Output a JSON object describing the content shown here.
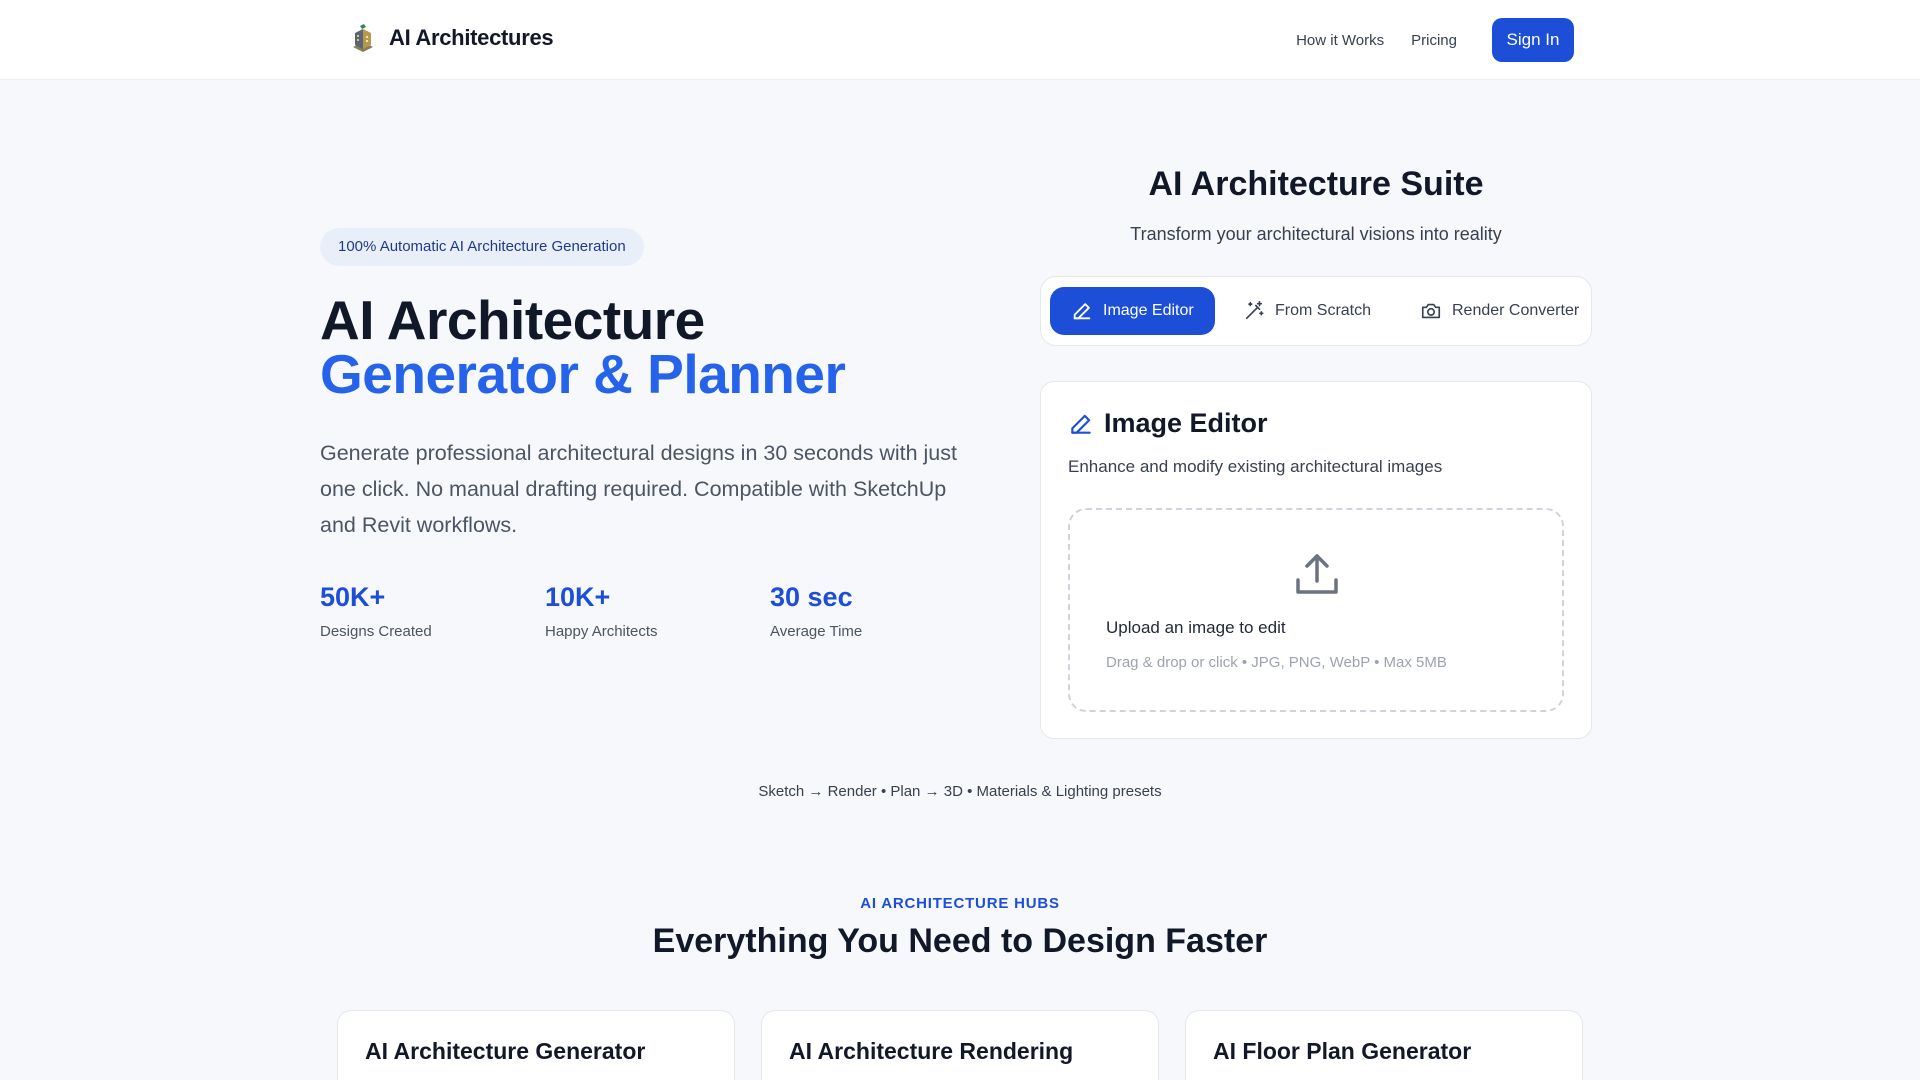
{
  "header": {
    "brand": "AI Architectures",
    "nav": [
      "How it Works",
      "Pricing"
    ],
    "sign_in": "Sign In"
  },
  "hero": {
    "badge": "100% Automatic AI Architecture Generation",
    "title_line1": "AI Architecture",
    "title_line2": "Generator & Planner",
    "lead": "Generate professional architectural designs in 30 seconds with just one click. No manual drafting required. Compatible with SketchUp and Revit workflows.",
    "stats": [
      {
        "value": "50K+",
        "label": "Designs Created"
      },
      {
        "value": "10K+",
        "label": "Happy Architects"
      },
      {
        "value": "30 sec",
        "label": "Average Time"
      }
    ]
  },
  "suite": {
    "title": "AI Architecture Suite",
    "subtitle": "Transform your architectural visions into reality",
    "tabs": [
      {
        "label": "Image Editor",
        "icon": "pencil-icon",
        "active": true
      },
      {
        "label": "From Scratch",
        "icon": "magic-wand-icon",
        "active": false
      },
      {
        "label": "Render Converter",
        "icon": "camera-icon",
        "active": false
      }
    ],
    "panel": {
      "title": "Image Editor",
      "subtitle": "Enhance and modify existing architectural images",
      "upload_title": "Upload an image to edit",
      "upload_hint": "Drag & drop or click • JPG, PNG, WebP • Max 5MB"
    }
  },
  "workflow_note": "Sketch → Render • Plan → 3D • Materials & Lighting presets",
  "hubs": {
    "eyebrow": "AI ARCHITECTURE HUBS",
    "title": "Everything You Need to Design Faster",
    "cards": [
      "AI Architecture Generator",
      "AI Architecture Rendering",
      "AI Floor Plan Generator"
    ]
  },
  "colors": {
    "accent": "#1d4ed8",
    "accent_text": "#2563eb",
    "background": "#f7f8fb",
    "card": "#ffffff"
  }
}
